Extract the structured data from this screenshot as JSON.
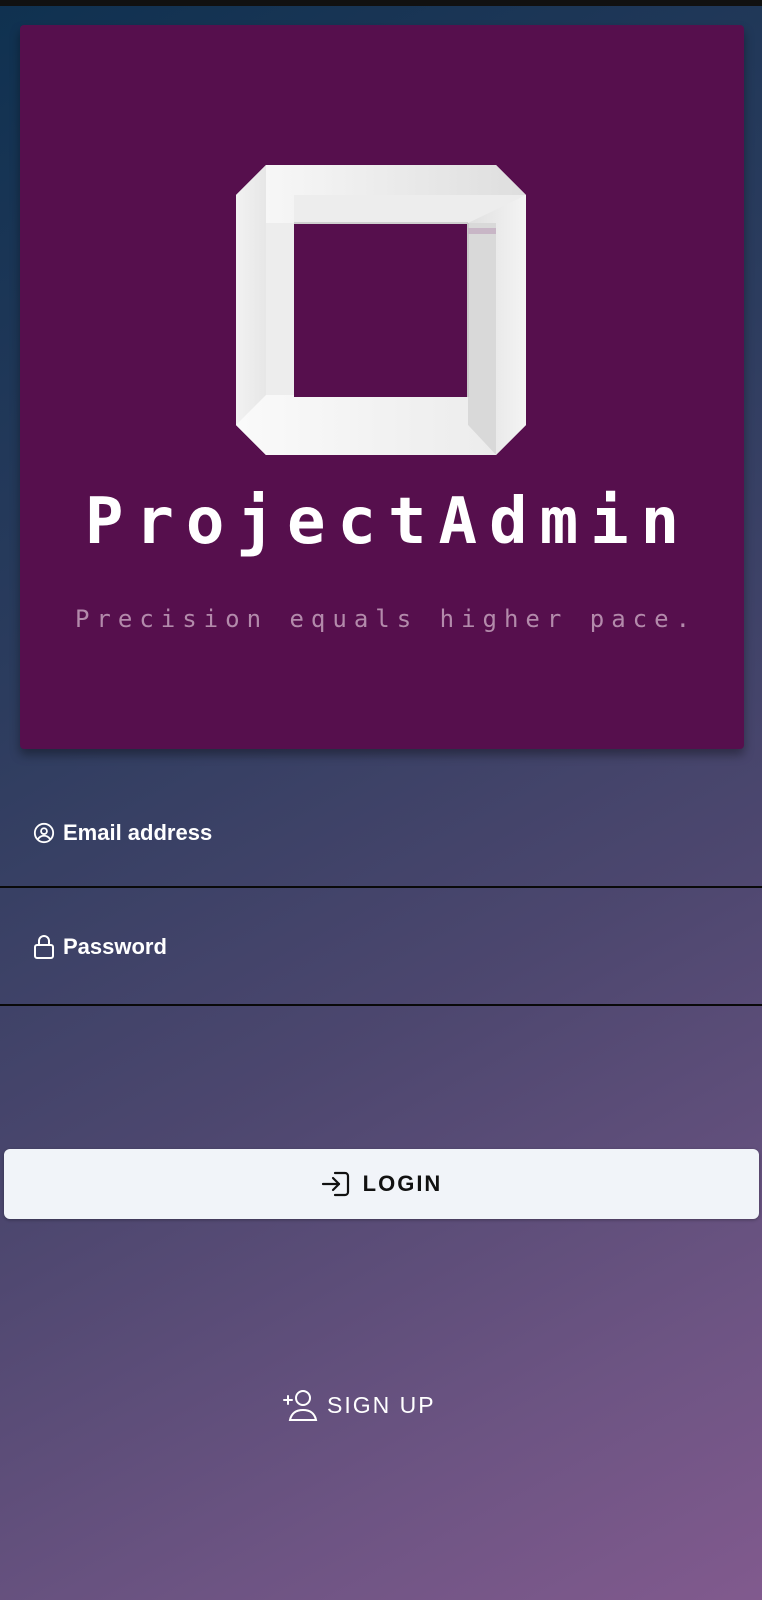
{
  "brand": {
    "title": "ProjectAdmin",
    "tagline": "Precision equals higher pace.",
    "logo_icon": "impossible-square-logo"
  },
  "form": {
    "email_label": "Email address",
    "email_icon": "user-circle-icon",
    "email_value": "",
    "password_label": "Password",
    "password_icon": "lock-icon",
    "password_value": ""
  },
  "actions": {
    "login_label": "LOGIN",
    "login_icon": "login-arrow-icon",
    "signup_label": "SIGN UP",
    "signup_icon": "add-user-icon"
  },
  "colors": {
    "hero_background": "#560f4d",
    "tagline": "#b38aab",
    "login_button": "#f1f4f9"
  }
}
